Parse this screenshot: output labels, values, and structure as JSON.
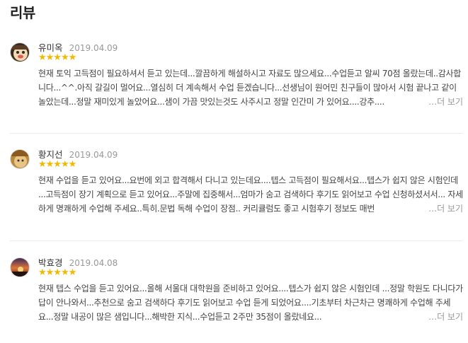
{
  "section": {
    "title": "리뷰"
  },
  "reviews": [
    {
      "author": "유미옥",
      "date": "2019.04.09",
      "stars": "★★★★★",
      "body": "현재 토익 고득점이 필요하셔서 듣고 있는데...깔끔하게 해설하시고 자료도 많으세요...수업듣고 알씨 70점 올랐는데..감사합니다...^^.아직 갈길이 멀어요...열심히 더 계속해서 수업 듣겠습니다...선생님이 원어민 친구들이 많아서 시험 끝나고 같이 놀았는데...정말 재미있게 놀았어요...샘이 가끔 맛있는것도 사주시고 정말 인간미 가 있어요....강추....",
      "more": "…더 보기",
      "avatar": "cartoon-face"
    },
    {
      "author": "황지선",
      "date": "2019.04.09",
      "stars": "★★★★★",
      "body": "현재 수업을 듣고 있어요...요번에 외고 합격해서 다니고 있는데요....텝스 고득점이 필요해서요...텝스가 쉽지 않은 시험인데 ...고득점이 장기 계획으로 듣고 있어요...주말에 집중해서...엄마가 숨고 검색하다 후기도 읽어보고 수업 신청하셨서서... 자세하게 명쾌하게 수업해 주세요..특히.문법 독해 수업이 장점.. 커리큘럼도 좋고 시험후기 정보도 매번",
      "more": "…더 보기",
      "avatar": "photo"
    },
    {
      "author": "박효경",
      "date": "2019.04.08",
      "stars": "★★★★★",
      "body": "현재 텝스 수업을 듣고 있어요...올해 서울대 대학원을 준비하고 있어요....텝스가 쉽지 않은 시험인데 ...정말 학원도 다니다가 답이 안나와서...추천으로 숨고 검색하다 후기도 읽어보고 수업 듣게 되었어요....기초부터 차근차근 명쾌하게 수업해 주세요...정말 내공이 많은 샘입니다...해박한 지식...수업듣고 2주만 35점이 올랐네요...",
      "more": "…더 보기",
      "avatar": "sunset"
    }
  ]
}
